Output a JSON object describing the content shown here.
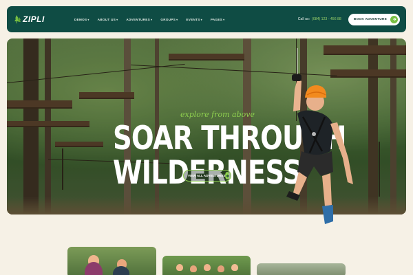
{
  "brand": {
    "name": "ZIPLI",
    "accent": "#79c043",
    "nav_bg": "#0f4c44",
    "page_bg": "#f6f1e6"
  },
  "nav": {
    "menu": [
      {
        "label": "DEMOS"
      },
      {
        "label": "ABOUT US"
      },
      {
        "label": "ADVENTURES"
      },
      {
        "label": "GROUPS"
      },
      {
        "label": "EVENTS"
      },
      {
        "label": "PAGES"
      }
    ],
    "call_label": "Call us:",
    "call_number": "(084) 123 - 456 88",
    "book_label": "BOOK ADVENTURE"
  },
  "hero": {
    "tagline": "explore from above",
    "headline_line1": "SOAR THROUGH",
    "headline_line2": "WILDERNESS",
    "button_label": "VIEW ALL ADVENTURES"
  },
  "icons": {
    "logo": "tree-icon",
    "nav_arrow": "arrow-right-icon",
    "hero_arrow": "arrow-right-icon",
    "menu_caret": "chevron-down-icon"
  }
}
